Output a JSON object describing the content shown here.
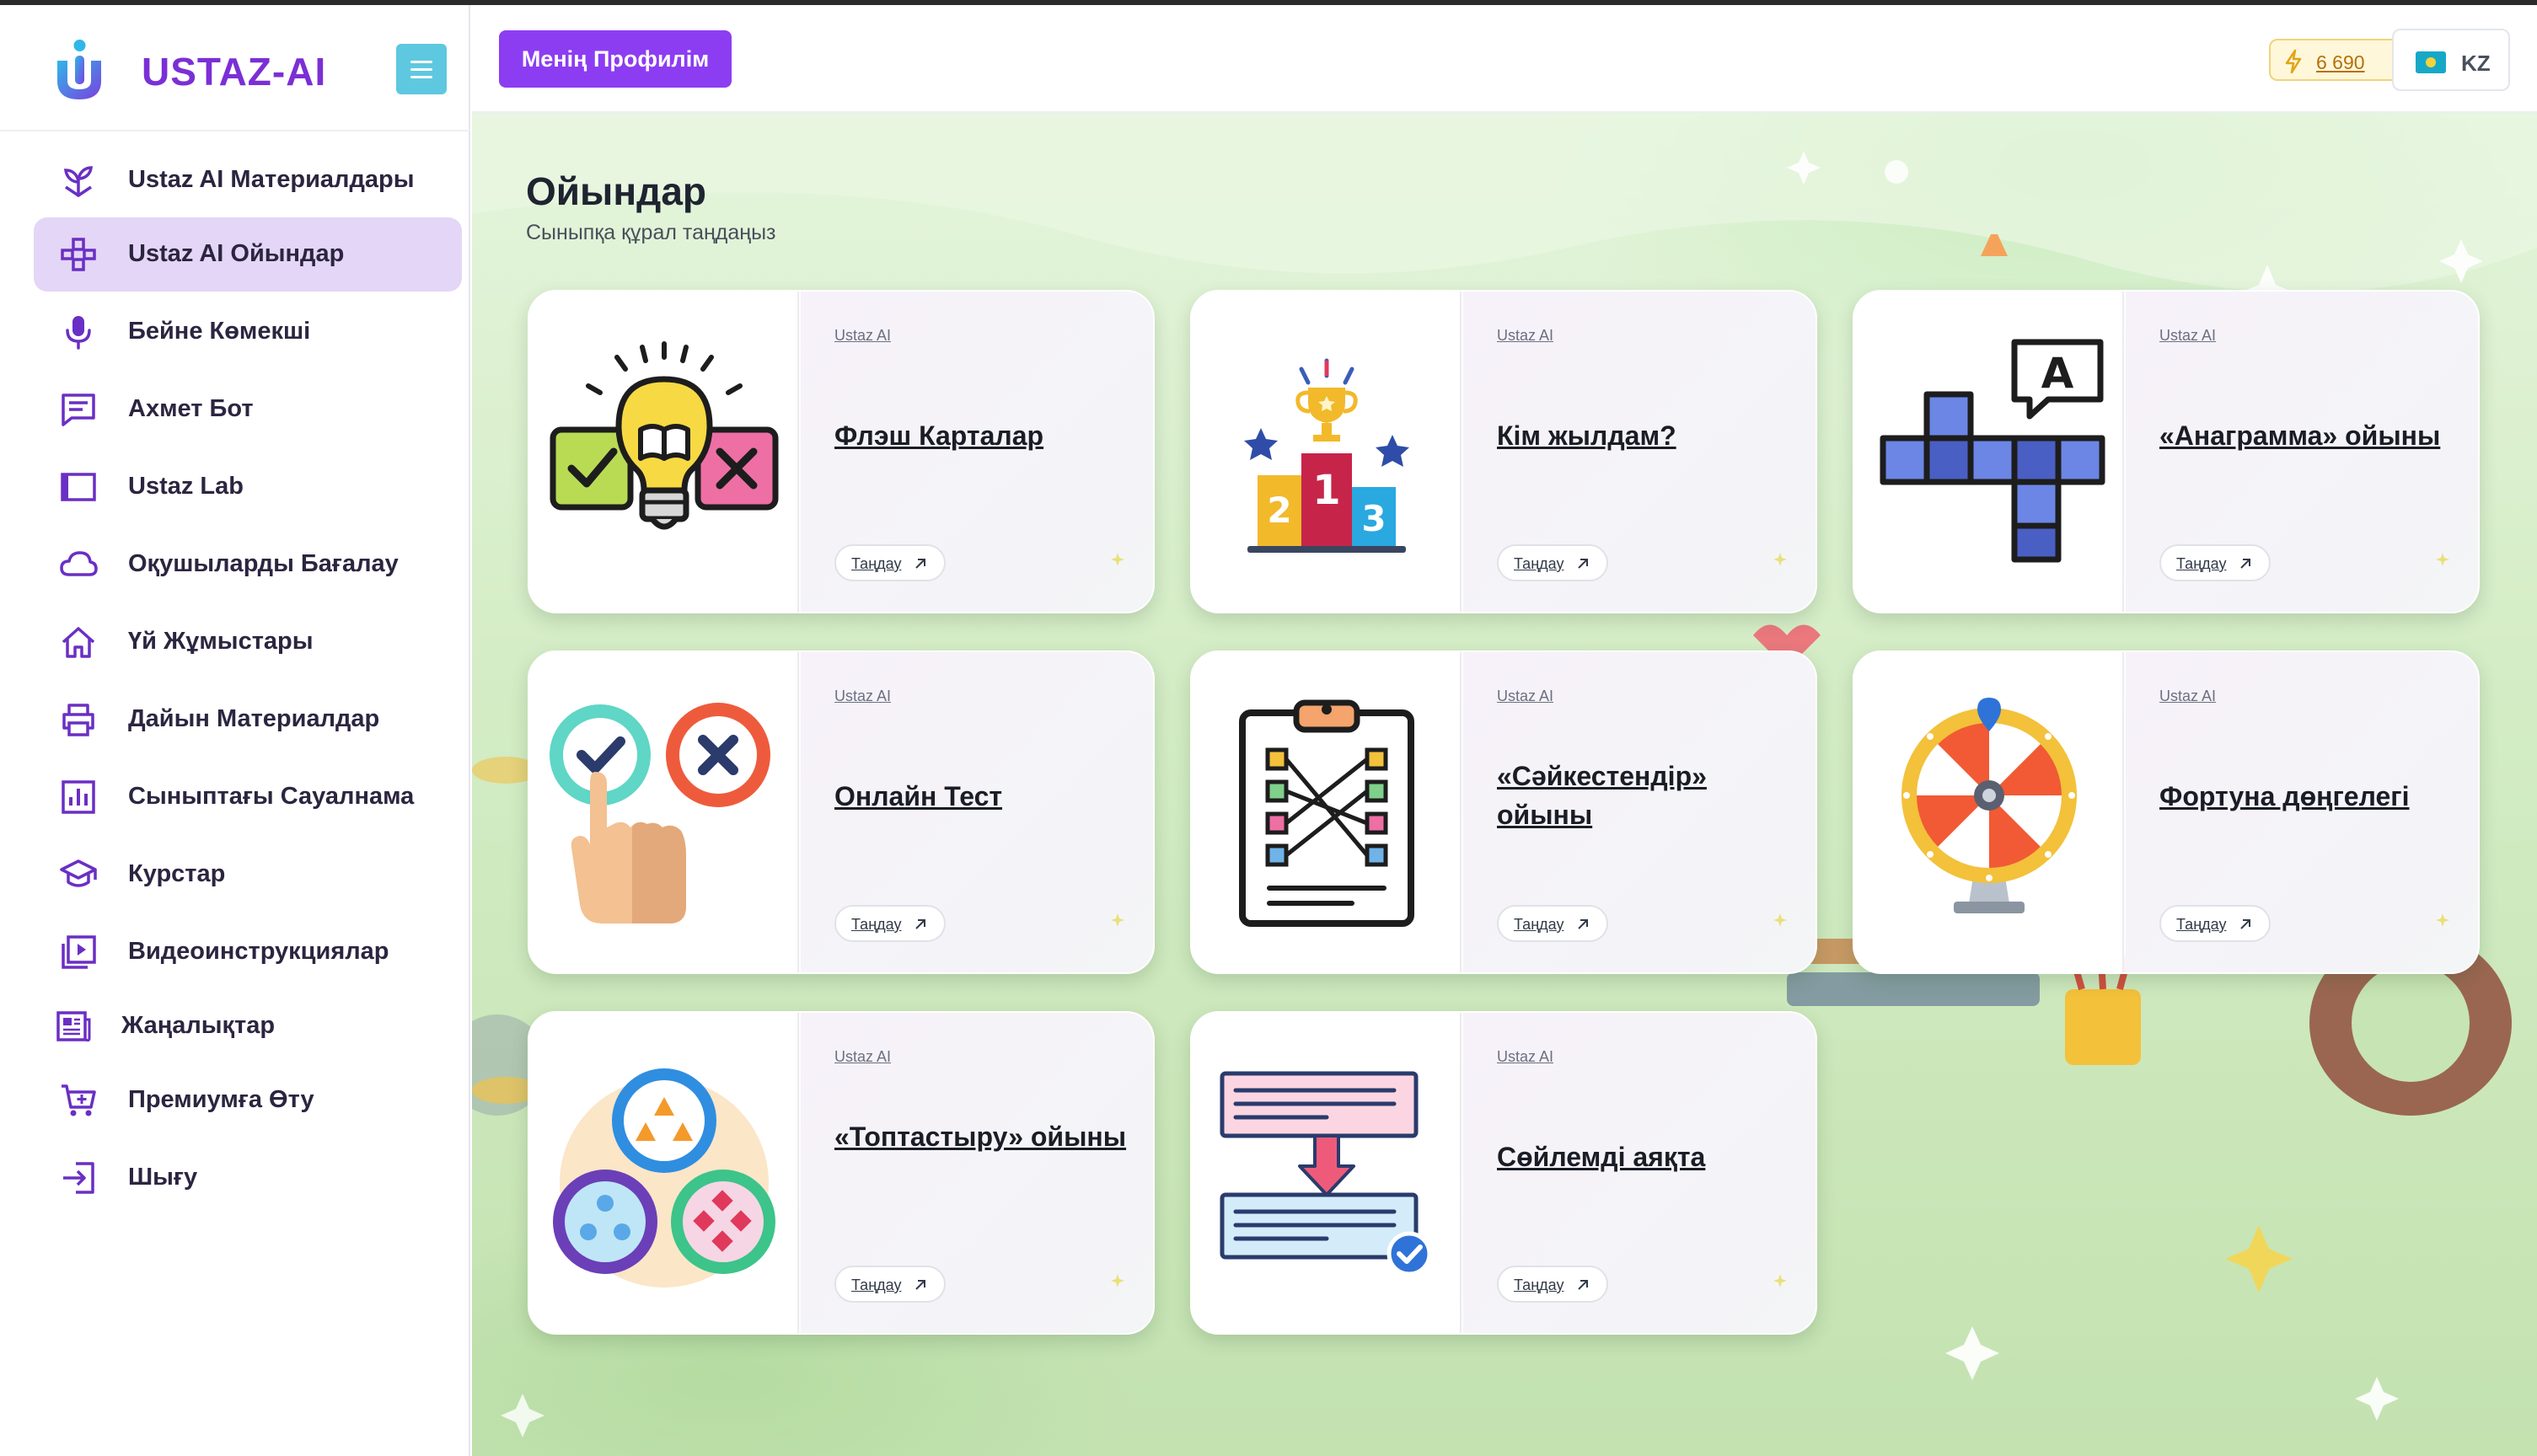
{
  "app": {
    "brand": "USTAZ-AI"
  },
  "sidebar": {
    "items": [
      {
        "label": "Ustaz AI Материалдары",
        "icon": "sprout-icon"
      },
      {
        "label": "Ustaz AI Ойындар",
        "icon": "gamepad-icon",
        "active": true
      },
      {
        "label": "Бейне Көмекші",
        "icon": "microphone-icon"
      },
      {
        "label": "Ахмет Бот",
        "icon": "chat-icon"
      },
      {
        "label": "Ustaz Lab",
        "icon": "window-icon"
      },
      {
        "label": "Оқушыларды Бағалау",
        "icon": "cloud-icon"
      },
      {
        "label": "Үй Жұмыстары",
        "icon": "home-icon"
      },
      {
        "label": "Дайын Материалдар",
        "icon": "printer-icon"
      },
      {
        "label": "Сыныптағы Сауалнама",
        "icon": "bar-chart-icon"
      },
      {
        "label": "Курстар",
        "icon": "graduation-cap-icon"
      },
      {
        "label": "Видеоинструкциялар",
        "icon": "video-icon"
      },
      {
        "label": "Жаңалықтар",
        "icon": "newspaper-icon"
      },
      {
        "label": "Премиумға Өту",
        "icon": "cart-icon"
      },
      {
        "label": "Шығу",
        "icon": "logout-icon"
      }
    ]
  },
  "topbar": {
    "profile_label": "Менің Профилім",
    "points": "6 690",
    "lang": "KZ"
  },
  "main": {
    "title": "Ойындар",
    "subtitle": "Сыныпқа құрал таңдаңыз"
  },
  "cards": [
    {
      "source": "Ustaz AI",
      "title": "Флэш Карталар",
      "select": "Таңдау",
      "image": "lightbulb-icon"
    },
    {
      "source": "Ustaz AI",
      "title": "Кім жылдам?",
      "select": "Таңдау",
      "image": "podium-icon"
    },
    {
      "source": "Ustaz AI",
      "title": "«Анаграмма» ойыны",
      "select": "Таңдау",
      "image": "crossword-icon"
    },
    {
      "source": "Ustaz AI",
      "title": "Онлайн Тест",
      "select": "Таңдау",
      "image": "quiz-hand-icon"
    },
    {
      "source": "Ustaz AI",
      "title": "«Сәйкестендір» ойыны",
      "select": "Таңдау",
      "image": "matching-clipboard-icon"
    },
    {
      "source": "Ustaz AI",
      "title": "Фортуна дөңгелегі",
      "select": "Таңдау",
      "image": "fortune-wheel-icon"
    },
    {
      "source": "Ustaz AI",
      "title": "«Топтастыру» ойыны",
      "select": "Таңдау",
      "image": "grouping-circles-icon"
    },
    {
      "source": "Ustaz AI",
      "title": "Сөйлемді аяқта",
      "select": "Таңдау",
      "image": "sentence-complete-icon"
    }
  ],
  "colors": {
    "brand": "#7b2fd6",
    "profile_button": "#8c3df2",
    "menu_button": "#5ec8e0",
    "active_nav": "#e4d6f6"
  }
}
